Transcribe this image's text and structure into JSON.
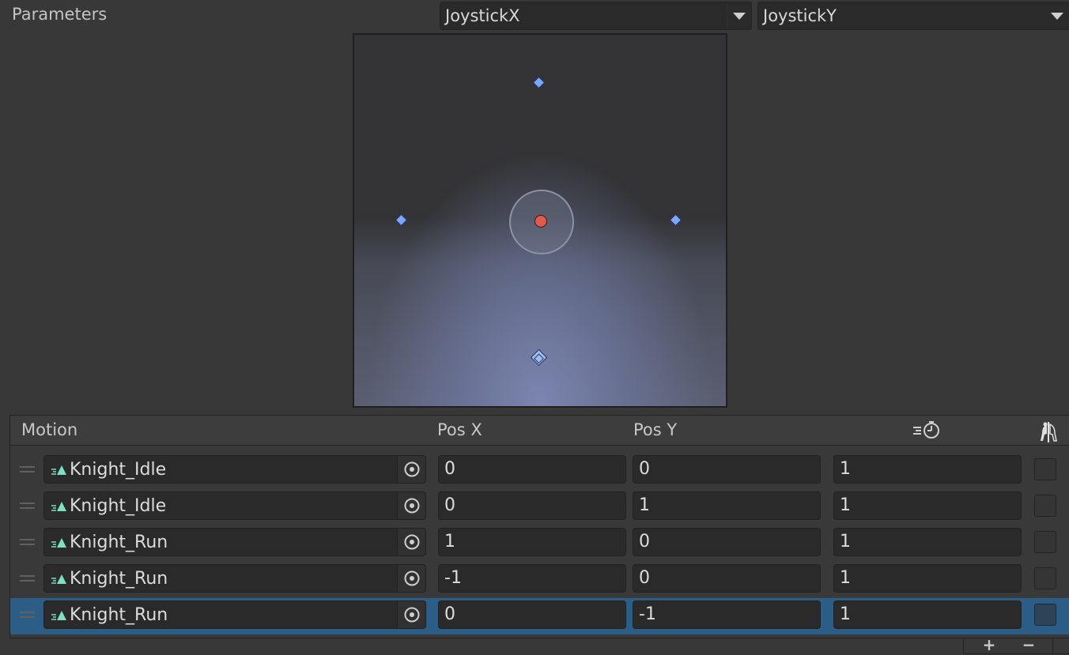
{
  "parameters": {
    "label": "Parameters",
    "param_x": "JoystickX",
    "param_y": "JoystickY"
  },
  "motion_table": {
    "headers": {
      "motion": "Motion",
      "pos_x": "Pos X",
      "pos_y": "Pos Y",
      "speed_icon": "speed-clock-icon",
      "mirror_icon": "mirror-icon"
    },
    "rows": [
      {
        "motion": "Knight_Idle",
        "pos_x": "0",
        "pos_y": "0",
        "speed": "1",
        "mirror": false,
        "selected": false
      },
      {
        "motion": "Knight_Idle",
        "pos_x": "0",
        "pos_y": "1",
        "speed": "1",
        "mirror": false,
        "selected": false
      },
      {
        "motion": "Knight_Run",
        "pos_x": "1",
        "pos_y": "0",
        "speed": "1",
        "mirror": false,
        "selected": false
      },
      {
        "motion": "Knight_Run",
        "pos_x": "-1",
        "pos_y": "0",
        "speed": "1",
        "mirror": false,
        "selected": false
      },
      {
        "motion": "Knight_Run",
        "pos_x": "0",
        "pos_y": "-1",
        "speed": "1",
        "mirror": false,
        "selected": true
      }
    ]
  },
  "footer": {
    "add_icon": "plus-icon",
    "remove_icon": "minus-icon"
  },
  "colors": {
    "background": "#383838",
    "selected_row": "#2c5d87",
    "motion_point": "#7ea6ff",
    "current_position": "#e05a4f",
    "clip_icon": "#7fe0c8"
  }
}
